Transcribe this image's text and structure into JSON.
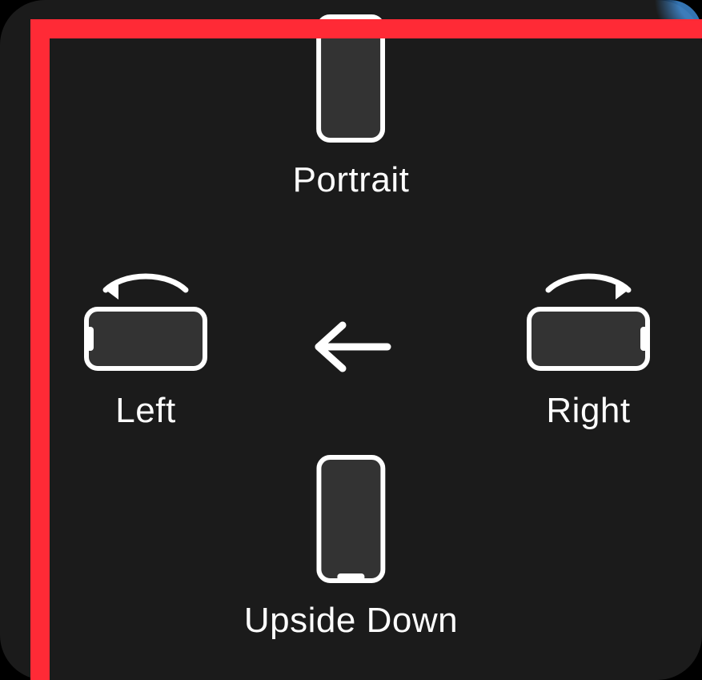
{
  "options": {
    "portrait": {
      "label": "Portrait"
    },
    "left": {
      "label": "Left"
    },
    "right": {
      "label": "Right"
    },
    "upside": {
      "label": "Upside Down"
    }
  },
  "colors": {
    "panel": "#1b1b1b",
    "text": "#fdfdfd",
    "stroke": "#ffffff",
    "annotation": "#ff2a36"
  }
}
